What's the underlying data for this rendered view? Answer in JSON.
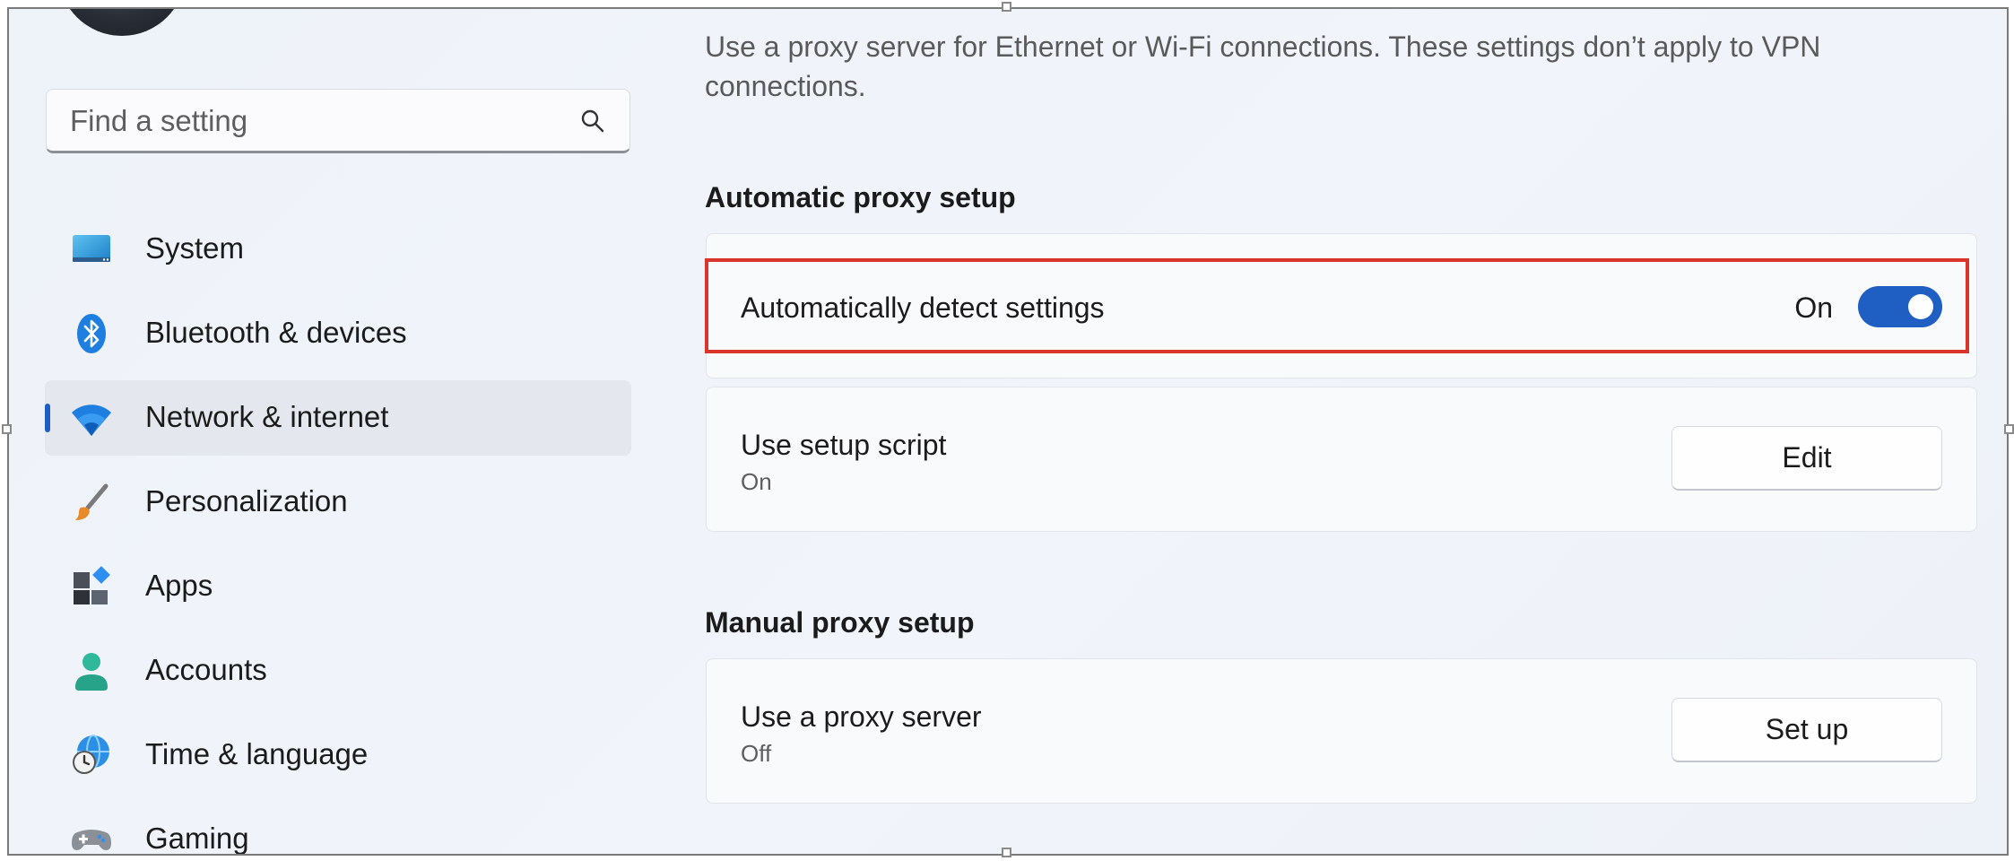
{
  "sidebar": {
    "search": {
      "placeholder": "Find a setting"
    },
    "items": [
      {
        "label": "System",
        "icon": "system-icon"
      },
      {
        "label": "Bluetooth & devices",
        "icon": "bluetooth-icon"
      },
      {
        "label": "Network & internet",
        "icon": "wifi-icon",
        "active": true
      },
      {
        "label": "Personalization",
        "icon": "brush-icon"
      },
      {
        "label": "Apps",
        "icon": "apps-icon"
      },
      {
        "label": "Accounts",
        "icon": "accounts-icon"
      },
      {
        "label": "Time & language",
        "icon": "globe-clock-icon"
      },
      {
        "label": "Gaming",
        "icon": "gamepad-icon"
      }
    ]
  },
  "main": {
    "description": "Use a proxy server for Ethernet or Wi-Fi connections. These settings don’t apply to VPN connections.",
    "automatic": {
      "title": "Automatic proxy setup",
      "detect": {
        "label": "Automatically detect settings",
        "state": "On",
        "enabled": true
      },
      "script": {
        "label": "Use setup script",
        "status": "On",
        "button": "Edit"
      }
    },
    "manual": {
      "title": "Manual proxy setup",
      "proxy": {
        "label": "Use a proxy server",
        "status": "Off",
        "button": "Set up"
      }
    }
  },
  "colors": {
    "accent": "#1f5fc4",
    "highlight": "#d9352a"
  }
}
